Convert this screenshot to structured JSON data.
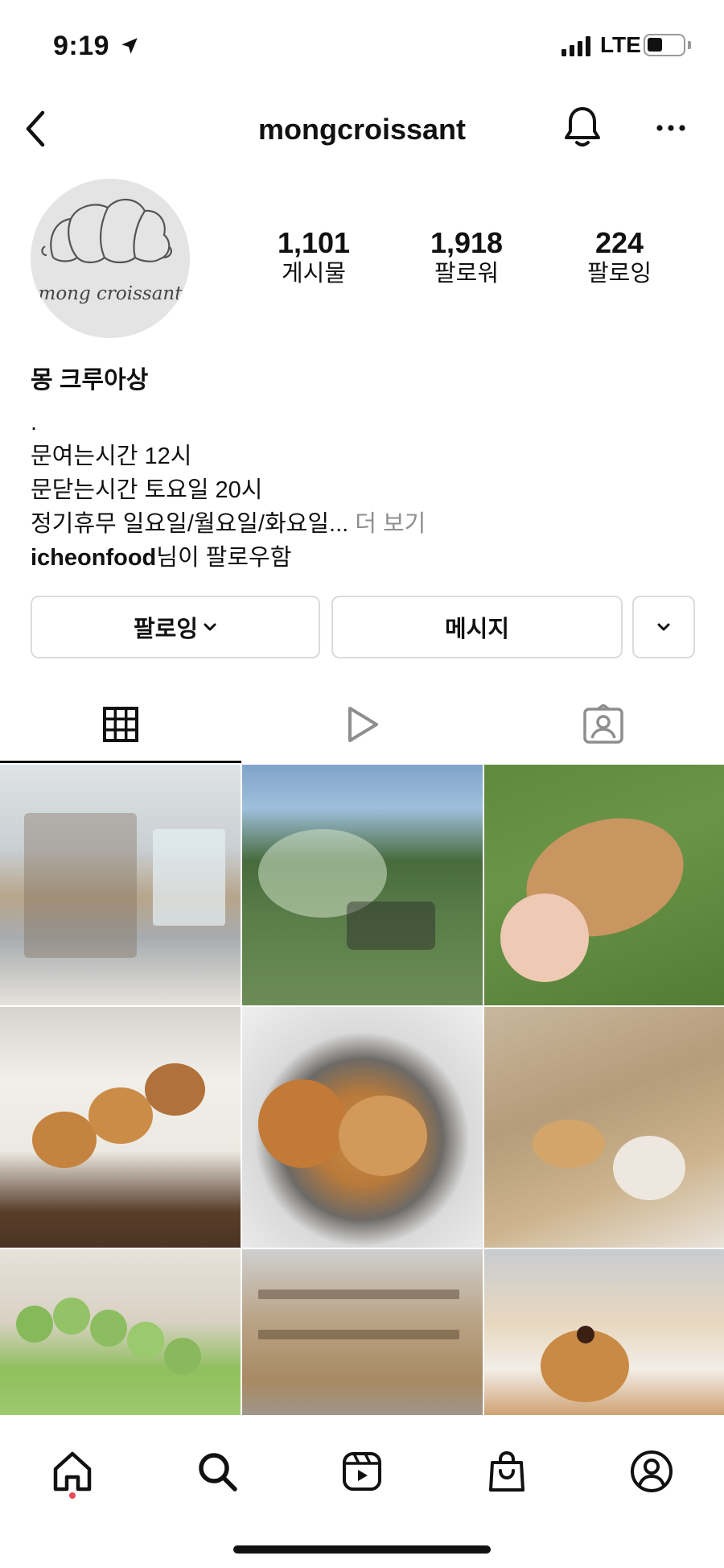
{
  "status_bar": {
    "time": "9:19",
    "network": "LTE",
    "icons": [
      "location-arrow-icon",
      "signal-icon",
      "battery-icon"
    ]
  },
  "header": {
    "username": "mongcroissant",
    "icons": [
      "back-icon",
      "bell-icon",
      "more-icon"
    ]
  },
  "profile": {
    "avatar_text": "mong croissant",
    "stats": [
      {
        "value": "1,101",
        "label": "게시물"
      },
      {
        "value": "1,918",
        "label": "팔로워"
      },
      {
        "value": "224",
        "label": "팔로잉"
      }
    ],
    "name": "몽 크루아상",
    "bio_lines": [
      ".",
      "문여는시간 12시",
      "문닫는시간 토요일 20시",
      "정기휴무 일요일/월요일/화요일..."
    ],
    "more_label": "더 보기",
    "followed_by_user": "icheonfood",
    "followed_by_suffix": "님이 팔로우함"
  },
  "actions": {
    "following_label": "팔로잉",
    "message_label": "메시지"
  },
  "tabs": [
    {
      "icon": "grid-icon",
      "active": true
    },
    {
      "icon": "reels-play-icon",
      "active": false
    },
    {
      "icon": "tagged-icon",
      "active": false
    }
  ],
  "grid_posts": [
    {
      "subject": "bakery-shelves-photo"
    },
    {
      "subject": "garden-photo"
    },
    {
      "subject": "almond-croissant-photo"
    },
    {
      "subject": "cream-buns-box-photo"
    },
    {
      "subject": "croissant-plate-photo"
    },
    {
      "subject": "pastry-boxes-photo"
    },
    {
      "subject": "green-grape-bread-photo"
    },
    {
      "subject": "bread-racks-photo"
    },
    {
      "subject": "cream-cups-photo"
    }
  ],
  "bottom_nav": [
    "home-icon",
    "search-icon",
    "reels-icon",
    "shop-icon",
    "profile-icon"
  ],
  "colors": {
    "accent_dot": "#ed4956",
    "border": "#dbdbdb",
    "muted_text": "#8e8e8e"
  }
}
